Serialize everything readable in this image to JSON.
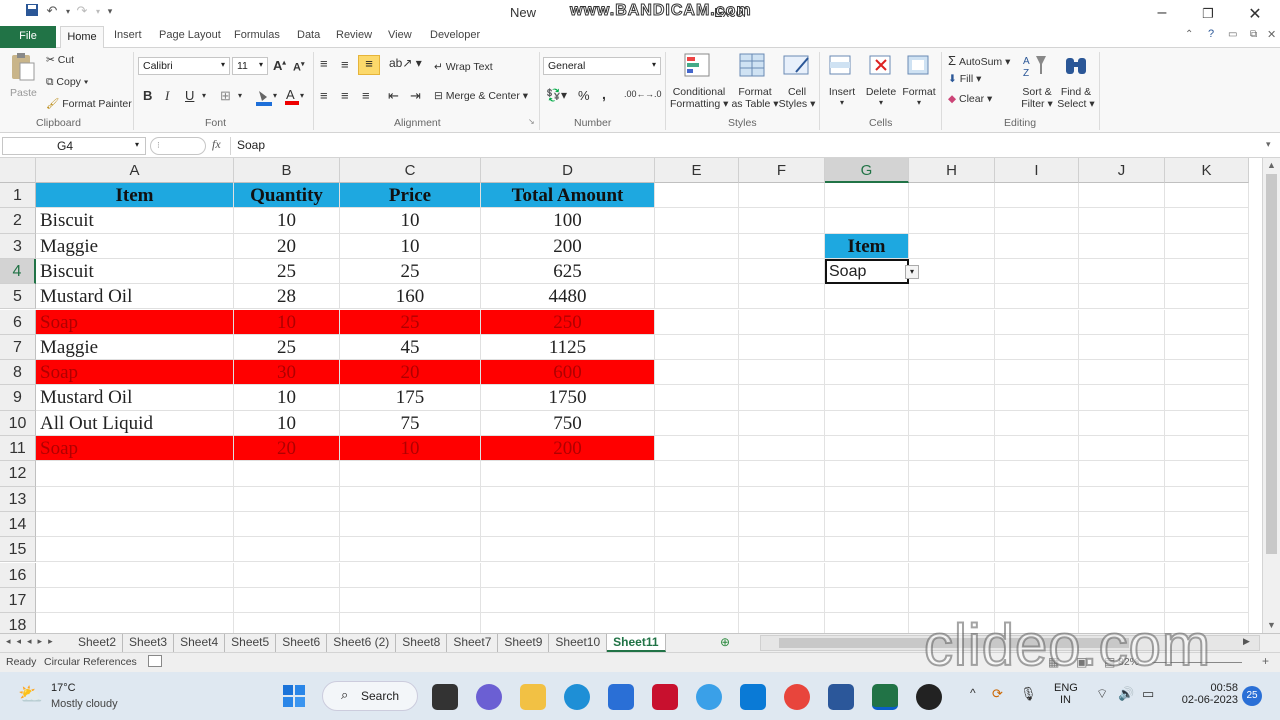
{
  "title_bar": {
    "title": "New",
    "app": "Excel",
    "watermark": "www.BANDICAM.com"
  },
  "tabs": [
    "File",
    "Home",
    "Insert",
    "Page Layout",
    "Formulas",
    "Data",
    "Review",
    "View",
    "Developer"
  ],
  "clipboard": {
    "paste": "Paste",
    "cut": "Cut",
    "copy": "Copy",
    "format_painter": "Format Painter",
    "group": "Clipboard"
  },
  "font": {
    "name": "Calibri",
    "size": "11",
    "bold": "B",
    "italic": "I",
    "underline": "U",
    "group": "Font"
  },
  "alignment": {
    "wrap": "Wrap Text",
    "merge": "Merge & Center",
    "group": "Alignment"
  },
  "number": {
    "format": "General",
    "percent": "%",
    "comma": ",",
    "group": "Number"
  },
  "styles": {
    "cond1": "Conditional",
    "cond2": "Formatting",
    "fmt1": "Format",
    "fmt2": "as Table",
    "cell1": "Cell",
    "cell2": "Styles",
    "group": "Styles"
  },
  "cells": {
    "insert": "Insert",
    "delete": "Delete",
    "format": "Format",
    "group": "Cells"
  },
  "editing": {
    "autosum": "AutoSum",
    "fill": "Fill",
    "clear": "Clear",
    "sort1": "Sort &",
    "sort2": "Filter",
    "find1": "Find &",
    "find2": "Select",
    "group": "Editing"
  },
  "formula_bar": {
    "name_box": "G4",
    "fx": "fx",
    "value": "Soap"
  },
  "columns": [
    "A",
    "B",
    "C",
    "D",
    "E",
    "F",
    "G",
    "H",
    "I",
    "J",
    "K"
  ],
  "rows": [
    "1",
    "2",
    "3",
    "4",
    "5",
    "6",
    "7",
    "8",
    "9",
    "10",
    "11",
    "12",
    "13",
    "14",
    "15",
    "16",
    "17",
    "18"
  ],
  "table": {
    "headers": [
      "Item",
      "Quantity",
      "Price",
      "Total Amount"
    ],
    "rows": [
      [
        "Biscuit",
        "10",
        "10",
        "100"
      ],
      [
        "Maggie",
        "20",
        "10",
        "200"
      ],
      [
        "Biscuit",
        "25",
        "25",
        "625"
      ],
      [
        "Mustard Oil",
        "28",
        "160",
        "4480"
      ],
      [
        "Soap",
        "10",
        "25",
        "250"
      ],
      [
        "Maggie",
        "25",
        "45",
        "1125"
      ],
      [
        "Soap",
        "30",
        "20",
        "600"
      ],
      [
        "Mustard Oil",
        "10",
        "175",
        "1750"
      ],
      [
        "All Out Liquid",
        "10",
        "75",
        "750"
      ],
      [
        "Soap",
        "20",
        "10",
        "200"
      ]
    ],
    "highlight_color": "#ff0000",
    "header_color": "#1ea8e0"
  },
  "criteria": {
    "header": "Item",
    "value": "Soap"
  },
  "sheets": [
    "Sheet2",
    "Sheet3",
    "Sheet4",
    "Sheet5",
    "Sheet6",
    "Sheet6 (2)",
    "Sheet8",
    "Sheet7",
    "Sheet9",
    "Sheet10",
    "Sheet11"
  ],
  "active_sheet": "Sheet11",
  "status": {
    "ready": "Ready",
    "circular": "Circular References",
    "zoom": "82%",
    "watermark": "clideo.com"
  },
  "taskbar": {
    "temp": "17°C",
    "weather": "Mostly cloudy",
    "search": "Search",
    "lang1": "ENG",
    "lang2": "IN",
    "time": "00:58",
    "date": "02-06-2023",
    "badge": "25"
  }
}
